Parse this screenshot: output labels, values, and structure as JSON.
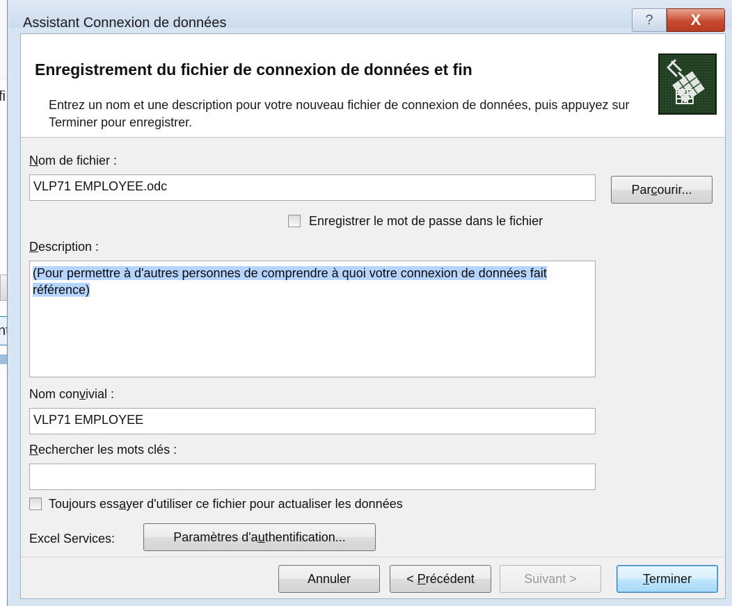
{
  "background": {
    "fragment_top_right": "fi",
    "fragment_mid": "nt"
  },
  "window": {
    "title": "Assistant Connexion de données",
    "help_glyph": "?",
    "close_glyph": "X"
  },
  "header": {
    "title": "Enregistrement du fichier de connexion de données et fin",
    "description": "Entrez un nom et une description pour votre nouveau fichier de connexion de données, puis appuyez sur Terminer pour enregistrer.",
    "icon": "data-connection-wizard-icon"
  },
  "form": {
    "filename": {
      "label_pre": "",
      "label_key": "N",
      "label_post": "om de fichier :",
      "value": "VLP71 EMPLOYEE.odc"
    },
    "browse_button": {
      "pre": "Par",
      "key": "c",
      "post": "ourir..."
    },
    "save_password": {
      "pre": "Enre",
      "key": "g",
      "post": "istrer le mot de passe dans le fichier",
      "checked": false
    },
    "description": {
      "label_key": "D",
      "label_post": "escription :",
      "value": "(Pour permettre à d'autres personnes de comprendre à quoi votre connexion de données fait référence)"
    },
    "friendly_name": {
      "label_pre": "Nom con",
      "label_key": "v",
      "label_post": "ivial :",
      "value": "VLP71 EMPLOYEE"
    },
    "keywords": {
      "label_key": "R",
      "label_post": "echercher les mots clés :",
      "value": ""
    },
    "always_use": {
      "pre": "Toujours ess",
      "key": "a",
      "post": "yer d'utiliser ce fichier pour actualiser les données",
      "checked": false
    },
    "excel_services": {
      "label": "Excel Services:",
      "button_pre": "Paramètres d'a",
      "button_key": "u",
      "button_post": "thentification..."
    }
  },
  "footer": {
    "cancel": "Annuler",
    "back_pre": "< ",
    "back_key": "P",
    "back_post": "récédent",
    "next": "Suivant >",
    "finish_key": "T",
    "finish_post": "erminer"
  }
}
